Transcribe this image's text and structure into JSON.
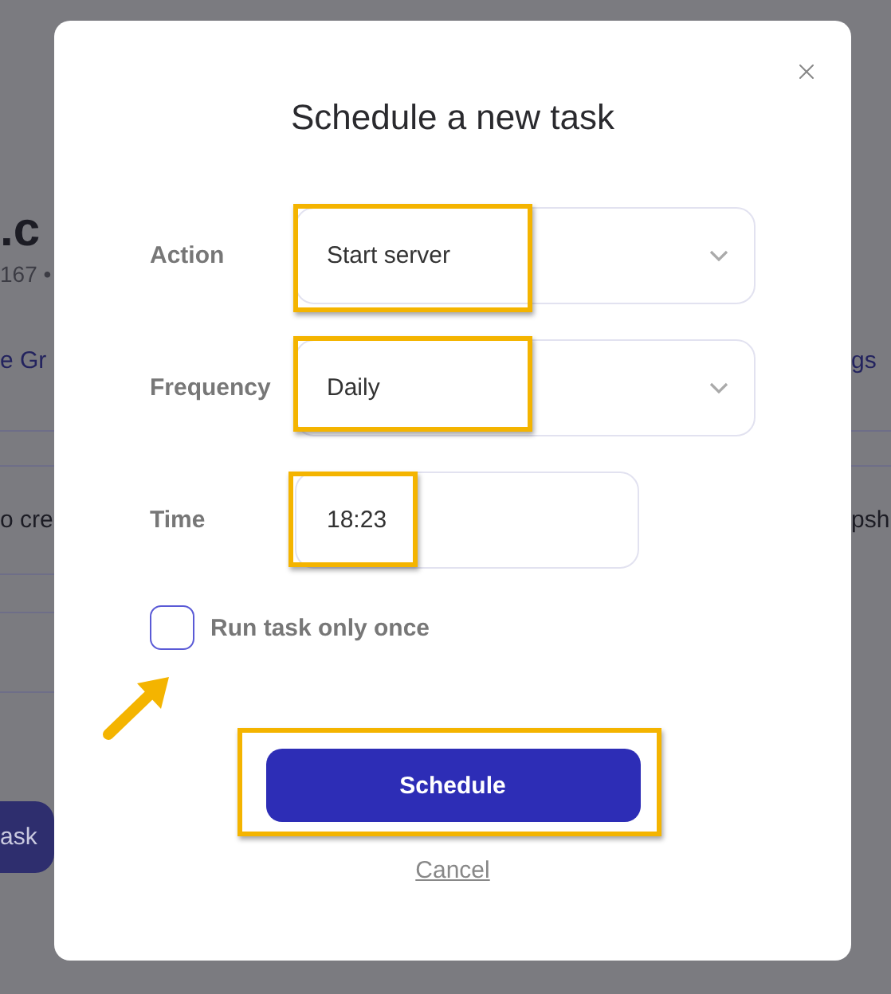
{
  "background": {
    "heading": ".c",
    "meta": "167 •",
    "link_left": "e Gr",
    "link_right": "gs",
    "row_left": "o cre",
    "row_right": "psh",
    "button": "ask"
  },
  "dialog": {
    "title": "Schedule a new task",
    "fields": [
      {
        "kind": "select",
        "label": "Action",
        "value": "Start server"
      },
      {
        "kind": "select",
        "label": "Frequency",
        "value": "Daily"
      },
      {
        "kind": "time",
        "label": "Time",
        "value": "18:23"
      }
    ],
    "checkbox": {
      "label": "Run task only once",
      "checked": false
    },
    "primary_button": "Schedule",
    "cancel_link": "Cancel"
  }
}
